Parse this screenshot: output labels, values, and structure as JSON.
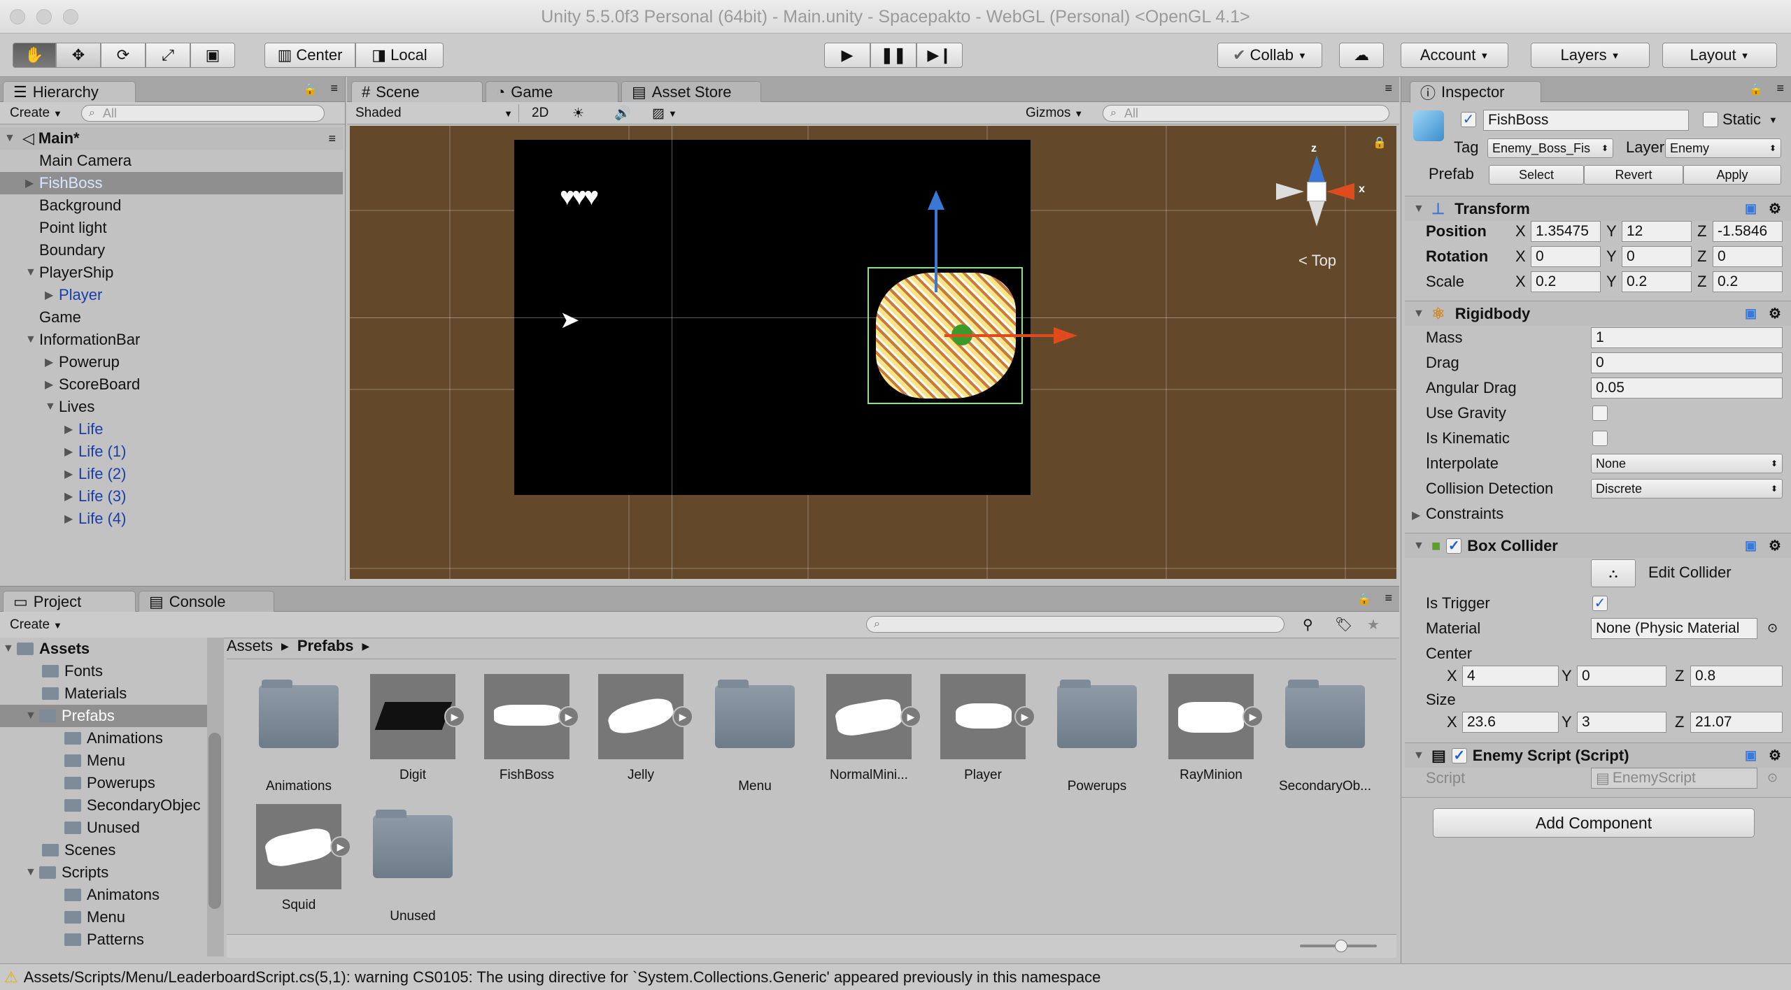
{
  "window": {
    "title": "Unity 5.5.0f3 Personal (64bit) - Main.unity - Spacepakto - WebGL (Personal) <OpenGL 4.1>"
  },
  "toolbar": {
    "pivot_label": "Center",
    "space_label": "Local",
    "collab_label": "Collab",
    "account_label": "Account",
    "layers_label": "Layers",
    "layout_label": "Layout"
  },
  "hierarchy": {
    "tab": "Hierarchy",
    "create_label": "Create",
    "search_placeholder": "All",
    "scene_name": "Main*",
    "items": [
      {
        "label": "Main Camera"
      },
      {
        "label": "FishBoss"
      },
      {
        "label": "Background"
      },
      {
        "label": "Point light"
      },
      {
        "label": "Boundary"
      },
      {
        "label": "PlayerShip"
      },
      {
        "label": "Player"
      },
      {
        "label": "Game"
      },
      {
        "label": "InformationBar"
      },
      {
        "label": "Powerup"
      },
      {
        "label": "ScoreBoard"
      },
      {
        "label": "Lives"
      },
      {
        "label": "Life"
      },
      {
        "label": "Life (1)"
      },
      {
        "label": "Life (2)"
      },
      {
        "label": "Life (3)"
      },
      {
        "label": "Life (4)"
      }
    ]
  },
  "scene": {
    "tabs": [
      "Scene",
      "Game",
      "Asset Store"
    ],
    "shading": "Shaded",
    "mode_2d": "2D",
    "gizmos_label": "Gizmos",
    "search_placeholder": "All",
    "gizmo_view": "Top",
    "axis_x": "x",
    "axis_z": "z"
  },
  "project": {
    "tabs": [
      "Project",
      "Console"
    ],
    "create_label": "Create",
    "breadcrumb": [
      "Assets",
      "Prefabs"
    ],
    "tree": [
      {
        "label": "Assets"
      },
      {
        "label": "Fonts"
      },
      {
        "label": "Materials"
      },
      {
        "label": "Prefabs"
      },
      {
        "label": "Animations"
      },
      {
        "label": "Menu"
      },
      {
        "label": "Powerups"
      },
      {
        "label": "SecondaryObjec"
      },
      {
        "label": "Unused"
      },
      {
        "label": "Scenes"
      },
      {
        "label": "Scripts"
      },
      {
        "label": "Animatons"
      },
      {
        "label": "Menu"
      },
      {
        "label": "Patterns"
      }
    ],
    "assets": [
      {
        "label": "Animations"
      },
      {
        "label": "Digit"
      },
      {
        "label": "FishBoss"
      },
      {
        "label": "Jelly"
      },
      {
        "label": "Menu"
      },
      {
        "label": "NormalMini..."
      },
      {
        "label": "Player"
      },
      {
        "label": "Powerups"
      },
      {
        "label": "RayMinion"
      },
      {
        "label": "SecondaryOb..."
      },
      {
        "label": "Squid"
      },
      {
        "label": "Unused"
      }
    ]
  },
  "inspector": {
    "tab": "Inspector",
    "object_name": "FishBoss",
    "static_label": "Static",
    "tag_label": "Tag",
    "tag_value": "Enemy_Boss_Fis",
    "layer_label": "Layer",
    "layer_value": "Enemy",
    "prefab_label": "Prefab",
    "prefab_select": "Select",
    "prefab_revert": "Revert",
    "prefab_apply": "Apply",
    "transform": {
      "title": "Transform",
      "position_label": "Position",
      "rotation_label": "Rotation",
      "scale_label": "Scale",
      "position": {
        "x": "1.35475",
        "y": "12",
        "z": "-1.5846"
      },
      "rotation": {
        "x": "0",
        "y": "0",
        "z": "0"
      },
      "scale": {
        "x": "0.2",
        "y": "0.2",
        "z": "0.2"
      }
    },
    "rigidbody": {
      "title": "Rigidbody",
      "mass_label": "Mass",
      "mass": "1",
      "drag_label": "Drag",
      "drag": "0",
      "angular_drag_label": "Angular Drag",
      "angular_drag": "0.05",
      "use_gravity_label": "Use Gravity",
      "is_kinematic_label": "Is Kinematic",
      "interpolate_label": "Interpolate",
      "interpolate": "None",
      "collision_label": "Collision Detection",
      "collision": "Discrete",
      "constraints_label": "Constraints"
    },
    "box_collider": {
      "title": "Box Collider",
      "edit_label": "Edit Collider",
      "is_trigger_label": "Is Trigger",
      "material_label": "Material",
      "material": "None (Physic Material",
      "center_label": "Center",
      "center": {
        "x": "4",
        "y": "0",
        "z": "0.8"
      },
      "size_label": "Size",
      "size": {
        "x": "23.6",
        "y": "3",
        "z": "21.07"
      }
    },
    "enemy_script": {
      "title": "Enemy Script (Script)",
      "script_label": "Script",
      "script_value": "EnemyScript"
    },
    "add_component": "Add Component"
  },
  "status_bar": {
    "message": "Assets/Scripts/Menu/LeaderboardScript.cs(5,1): warning CS0105: The using directive for `System.Collections.Generic' appeared previously in this namespace"
  },
  "colors": {
    "scene_bg": "#63492a",
    "selection": "#8f8f8f",
    "link_blue": "#1a3fa8"
  }
}
